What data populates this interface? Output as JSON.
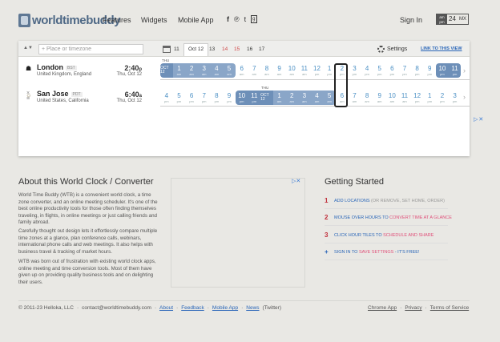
{
  "header": {
    "logo_text": "worldtimebuddy",
    "nav": [
      "Features",
      "Widgets",
      "Mobile App"
    ],
    "social_icons": [
      "facebook-icon",
      "pinterest-icon",
      "twitter-icon",
      "google-plus-icon"
    ],
    "social_glyphs": [
      "f",
      "℗",
      "t",
      "g"
    ],
    "signin": "Sign In",
    "format": {
      "ampm_top": "am",
      "ampm_bottom": "pm",
      "h24": "24",
      "mx": "MX"
    }
  },
  "toolbar": {
    "sort_glyph": "▲▼",
    "place_placeholder": "+ Place or timezone",
    "days": [
      {
        "label": "11",
        "style": "normal"
      },
      {
        "label": "Oct 12",
        "style": "selected"
      },
      {
        "label": "13",
        "style": "normal"
      },
      {
        "label": "14",
        "style": "red"
      },
      {
        "label": "15",
        "style": "red"
      },
      {
        "label": "16",
        "style": "normal"
      },
      {
        "label": "17",
        "style": "normal"
      }
    ],
    "settings": "Settings",
    "link_view": "LINK TO THIS VIEW"
  },
  "rows": [
    {
      "city": "London",
      "abbr": "BST",
      "region": "United Kingdom, England",
      "time": "2:40",
      "suffix": "p",
      "date": "Thu, Oct 12",
      "marker": "THU",
      "hours": [
        {
          "n": "OCT 12",
          "s": "",
          "t": "date"
        },
        {
          "n": "1",
          "s": "am",
          "t": "night"
        },
        {
          "n": "2",
          "s": "am",
          "t": "night"
        },
        {
          "n": "3",
          "s": "am",
          "t": "night"
        },
        {
          "n": "4",
          "s": "am",
          "t": "night"
        },
        {
          "n": "5",
          "s": "am",
          "t": "night"
        },
        {
          "n": "6",
          "s": "am",
          "t": "day"
        },
        {
          "n": "7",
          "s": "am",
          "t": "day"
        },
        {
          "n": "8",
          "s": "am",
          "t": "day"
        },
        {
          "n": "9",
          "s": "am",
          "t": "day"
        },
        {
          "n": "10",
          "s": "am",
          "t": "day"
        },
        {
          "n": "11",
          "s": "am",
          "t": "day"
        },
        {
          "n": "12",
          "s": "pm",
          "t": "day"
        },
        {
          "n": "1",
          "s": "pm",
          "t": "day"
        },
        {
          "n": "2",
          "s": "pm",
          "t": "day"
        },
        {
          "n": "3",
          "s": "pm",
          "t": "day"
        },
        {
          "n": "4",
          "s": "pm",
          "t": "day"
        },
        {
          "n": "5",
          "s": "pm",
          "t": "day"
        },
        {
          "n": "6",
          "s": "pm",
          "t": "day"
        },
        {
          "n": "7",
          "s": "pm",
          "t": "day"
        },
        {
          "n": "8",
          "s": "pm",
          "t": "day"
        },
        {
          "n": "9",
          "s": "pm",
          "t": "day"
        },
        {
          "n": "10",
          "s": "pm",
          "t": "dark"
        },
        {
          "n": "11",
          "s": "pm",
          "t": "dark"
        }
      ]
    },
    {
      "city": "San Jose",
      "abbr": "PDT",
      "region": "United States, California",
      "time": "6:40",
      "suffix": "a",
      "date": "Thu, Oct 12",
      "marker": "THU",
      "hours": [
        {
          "n": "4",
          "s": "pm",
          "t": "day"
        },
        {
          "n": "5",
          "s": "pm",
          "t": "day"
        },
        {
          "n": "6",
          "s": "pm",
          "t": "day"
        },
        {
          "n": "7",
          "s": "pm",
          "t": "day"
        },
        {
          "n": "8",
          "s": "pm",
          "t": "day"
        },
        {
          "n": "9",
          "s": "pm",
          "t": "day"
        },
        {
          "n": "10",
          "s": "pm",
          "t": "dark"
        },
        {
          "n": "11",
          "s": "pm",
          "t": "dark"
        },
        {
          "n": "OCT 12",
          "s": "",
          "t": "date"
        },
        {
          "n": "1",
          "s": "am",
          "t": "night"
        },
        {
          "n": "2",
          "s": "am",
          "t": "night"
        },
        {
          "n": "3",
          "s": "am",
          "t": "night"
        },
        {
          "n": "4",
          "s": "am",
          "t": "night"
        },
        {
          "n": "5",
          "s": "am",
          "t": "night"
        },
        {
          "n": "6",
          "s": "am",
          "t": "day"
        },
        {
          "n": "7",
          "s": "am",
          "t": "day"
        },
        {
          "n": "8",
          "s": "am",
          "t": "day"
        },
        {
          "n": "9",
          "s": "am",
          "t": "day"
        },
        {
          "n": "10",
          "s": "am",
          "t": "day"
        },
        {
          "n": "11",
          "s": "am",
          "t": "day"
        },
        {
          "n": "12",
          "s": "pm",
          "t": "day"
        },
        {
          "n": "1",
          "s": "pm",
          "t": "day"
        },
        {
          "n": "2",
          "s": "pm",
          "t": "day"
        },
        {
          "n": "3",
          "s": "pm",
          "t": "day"
        }
      ]
    }
  ],
  "about": {
    "title": "About this World Clock / Converter",
    "p1": "World Time Buddy (WTB) is a convenient world clock, a time zone converter, and an online meeting scheduler. It's one of the best online productivity tools for those often finding themselves traveling, in flights, in online meetings or just calling friends and family abroad.",
    "p2": "Carefully thought out design lets it effortlessly compare multiple time zones at a glance, plan conference calls, webinars, international phone calls and web meetings. It also helps with business travel & tracking of market hours.",
    "p3": "WTB was born out of frustration with existing world clock apps, online meeting and time conversion tools. Most of them have given up on providing quality business tools and on delighting their users."
  },
  "getting_started": {
    "title": "Getting Started",
    "items": [
      {
        "num": "1",
        "text": "Add locations",
        "extra": " (or remove, set home, order)",
        "hl": ""
      },
      {
        "num": "2",
        "text": "Mouse over hours to ",
        "extra": "",
        "hl": "convert time at a glance"
      },
      {
        "num": "3",
        "text": "Click hour tiles to ",
        "extra": "",
        "hl": "schedule and share"
      },
      {
        "num": "+",
        "text": "Sign in to ",
        "extra": " - it's free!",
        "hl": "save settings"
      }
    ]
  },
  "footer": {
    "copyright": "© 2011-23 Helloka, LLC",
    "sep": "·",
    "email": "contact@worldtimebuddy.com",
    "about": "About",
    "feedback": "Feedback",
    "mobile": "Mobile App",
    "news": "News",
    "twitter": "(Twitter)",
    "chrome": "Chrome App",
    "privacy": "Privacy",
    "tos": "Terms of Service"
  },
  "colors": {
    "accent": "#2a66b8",
    "night": "#8aa6c8",
    "date": "#6d8fb8",
    "red": "#c0303c"
  }
}
